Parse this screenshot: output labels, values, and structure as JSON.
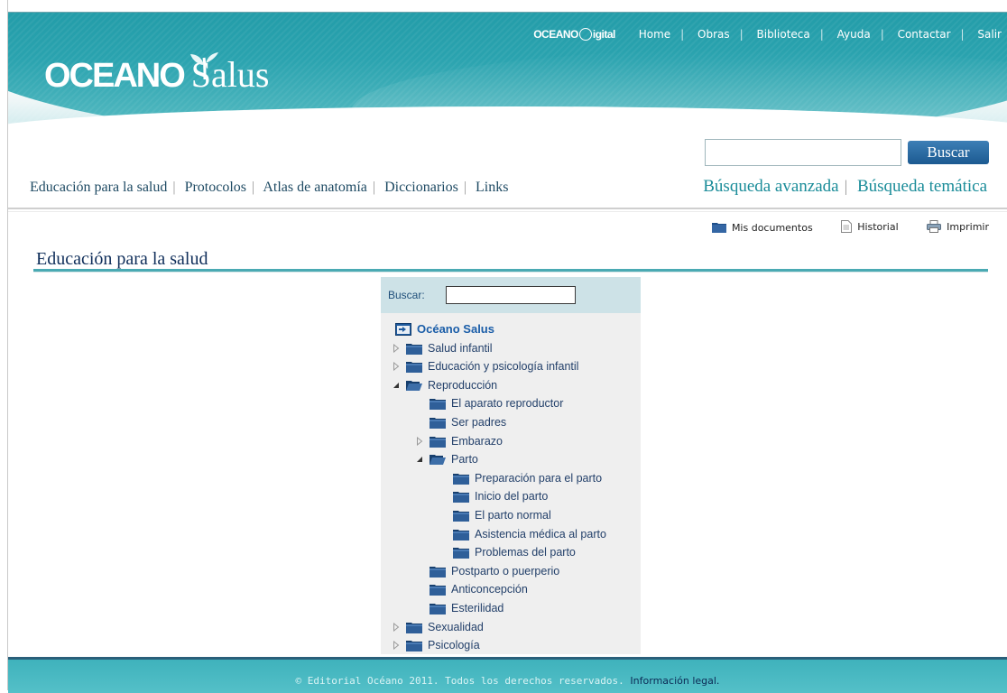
{
  "top_nav": {
    "brand": "OCEANO Digital",
    "brand_prefix": "OCEANO",
    "brand_suffix": "igital",
    "items": [
      "Home",
      "Obras",
      "Biblioteca",
      "Ayuda",
      "Contactar",
      "Salir"
    ]
  },
  "logo": {
    "part1": "OCEANO",
    "part2": "Salus"
  },
  "search": {
    "button_label": "Buscar",
    "value": ""
  },
  "main_nav": [
    "Educación para la salud",
    "Protocolos",
    "Atlas de anatomía",
    "Diccionarios",
    "Links"
  ],
  "adv_nav": [
    "Búsqueda avanzada",
    "Búsqueda temática"
  ],
  "tools": [
    {
      "label": "Mis documentos",
      "icon": "folder-icon"
    },
    {
      "label": "Historial",
      "icon": "document-icon"
    },
    {
      "label": "Imprimir",
      "icon": "printer-icon"
    }
  ],
  "page_title": "Educación para la salud",
  "tree_panel": {
    "search_label": "Buscar:",
    "root": "Océano Salus",
    "items": [
      {
        "label": "Salud infantil",
        "level": 0,
        "toggle": "closed",
        "folder": "closed"
      },
      {
        "label": "Educación y psicología infantil",
        "level": 0,
        "toggle": "closed",
        "folder": "closed"
      },
      {
        "label": "Reproducción",
        "level": 0,
        "toggle": "open",
        "folder": "open"
      },
      {
        "label": "El aparato reproductor",
        "level": 1,
        "toggle": "none",
        "folder": "closed"
      },
      {
        "label": "Ser padres",
        "level": 1,
        "toggle": "none",
        "folder": "closed"
      },
      {
        "label": "Embarazo",
        "level": 1,
        "toggle": "closed",
        "folder": "closed"
      },
      {
        "label": "Parto",
        "level": 1,
        "toggle": "open",
        "folder": "open"
      },
      {
        "label": "Preparación para el parto",
        "level": 2,
        "toggle": "none",
        "folder": "closed"
      },
      {
        "label": "Inicio del parto",
        "level": 2,
        "toggle": "none",
        "folder": "closed"
      },
      {
        "label": "El parto normal",
        "level": 2,
        "toggle": "none",
        "folder": "closed"
      },
      {
        "label": "Asistencia médica al parto",
        "level": 2,
        "toggle": "none",
        "folder": "closed"
      },
      {
        "label": "Problemas del parto",
        "level": 2,
        "toggle": "none",
        "folder": "closed"
      },
      {
        "label": "Postparto o puerperio",
        "level": 1,
        "toggle": "none",
        "folder": "closed"
      },
      {
        "label": "Anticoncepción",
        "level": 1,
        "toggle": "none",
        "folder": "closed"
      },
      {
        "label": "Esterilidad",
        "level": 1,
        "toggle": "none",
        "folder": "closed"
      },
      {
        "label": "Sexualidad",
        "level": 0,
        "toggle": "closed",
        "folder": "closed"
      },
      {
        "label": "Psicología",
        "level": 0,
        "toggle": "closed",
        "folder": "closed"
      }
    ]
  },
  "footer": {
    "copyright": "© Editorial Océano 2011. Todos los derechos reservados.",
    "legal_link": "Información legal."
  },
  "colors": {
    "header_teal": "#1a93a0",
    "nav_text": "#1e4a63",
    "accent_teal": "#1a8c99",
    "title_navy": "#0f2e5a",
    "button_blue": "#1c5a91",
    "footer_teal": "#46b6bf"
  }
}
